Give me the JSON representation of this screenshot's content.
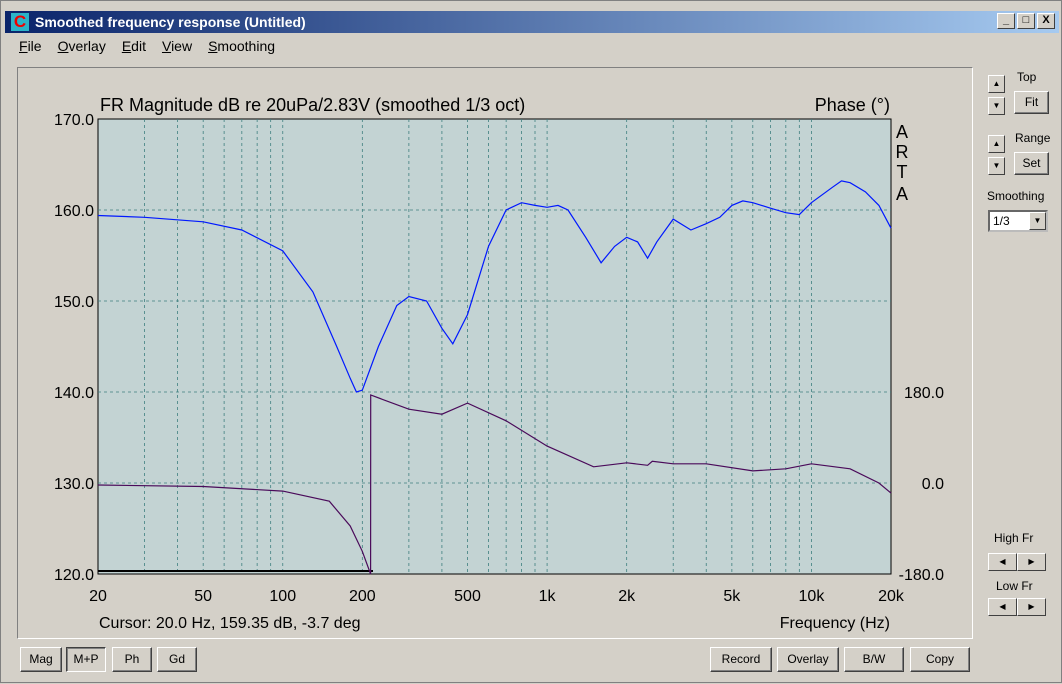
{
  "window": {
    "title": "Smoothed frequency response (Untitled)",
    "app_icon": "arta-icon",
    "controls": [
      "_",
      "□",
      "X"
    ]
  },
  "menu": [
    "File",
    "Overlay",
    "Edit",
    "View",
    "Smoothing"
  ],
  "plot": {
    "title": "FR Magnitude dB re 20uPa/2.83V (smoothed 1/3 oct)",
    "right_title": "Phase (°)",
    "watermark": [
      "A",
      "R",
      "T",
      "A"
    ],
    "cursor": "Cursor: 20.0 Hz, 159.35 dB, -3.7 deg",
    "xlabel": "Frequency (Hz)"
  },
  "side": {
    "top_label": "Top",
    "fit": "Fit",
    "range_label": "Range",
    "set": "Set",
    "smoothing_label": "Smoothing",
    "smoothing_value": "1/3",
    "high_fr": "High Fr",
    "low_fr": "Low Fr"
  },
  "buttons": {
    "mag": "Mag",
    "mp": "M+P",
    "ph": "Ph",
    "gd": "Gd",
    "record": "Record",
    "overlay": "Overlay",
    "bw": "B/W",
    "copy": "Copy"
  },
  "chart_data": {
    "type": "line",
    "xscale": "log",
    "xlim": [
      20,
      20000
    ],
    "ylim": [
      120,
      170
    ],
    "y2lim": [
      -180,
      180
    ],
    "xticks": [
      {
        "v": 20,
        "l": "20"
      },
      {
        "v": 50,
        "l": "50"
      },
      {
        "v": 100,
        "l": "100"
      },
      {
        "v": 200,
        "l": "200"
      },
      {
        "v": 500,
        "l": "500"
      },
      {
        "v": 1000,
        "l": "1k"
      },
      {
        "v": 2000,
        "l": "2k"
      },
      {
        "v": 5000,
        "l": "5k"
      },
      {
        "v": 10000,
        "l": "10k"
      },
      {
        "v": 20000,
        "l": "20k"
      }
    ],
    "yticks": [
      "120.0",
      "130.0",
      "140.0",
      "150.0",
      "160.0",
      "170.0"
    ],
    "y2ticks": [
      {
        "v": 180,
        "l": "180.0"
      },
      {
        "v": 0,
        "l": "0.0"
      },
      {
        "v": -180,
        "l": "-180.0"
      }
    ],
    "colors": {
      "magnitude": "#0018ff",
      "phase": "#4a0a5a",
      "bg": "#c3d3d3",
      "grid": "#3f7f7f"
    },
    "series": [
      {
        "name": "Magnitude (dB)",
        "axis": "left",
        "points": [
          [
            20,
            159.4
          ],
          [
            30,
            159.2
          ],
          [
            50,
            158.7
          ],
          [
            70,
            157.8
          ],
          [
            100,
            155.5
          ],
          [
            130,
            151
          ],
          [
            160,
            145
          ],
          [
            180,
            141.5
          ],
          [
            190,
            140
          ],
          [
            200,
            140.2
          ],
          [
            230,
            145
          ],
          [
            270,
            149.5
          ],
          [
            300,
            150.5
          ],
          [
            350,
            150
          ],
          [
            400,
            147
          ],
          [
            440,
            145.3
          ],
          [
            500,
            148.5
          ],
          [
            600,
            156
          ],
          [
            700,
            160
          ],
          [
            800,
            160.8
          ],
          [
            900,
            160.5
          ],
          [
            1000,
            160.3
          ],
          [
            1100,
            160.5
          ],
          [
            1200,
            160
          ],
          [
            1400,
            157
          ],
          [
            1600,
            154.2
          ],
          [
            1800,
            156
          ],
          [
            2000,
            157
          ],
          [
            2200,
            156.5
          ],
          [
            2400,
            154.7
          ],
          [
            2600,
            156.5
          ],
          [
            3000,
            159
          ],
          [
            3500,
            157.8
          ],
          [
            4000,
            158.5
          ],
          [
            4500,
            159.2
          ],
          [
            5000,
            160.5
          ],
          [
            5500,
            161
          ],
          [
            6000,
            160.8
          ],
          [
            7000,
            160.2
          ],
          [
            8000,
            159.7
          ],
          [
            9000,
            159.5
          ],
          [
            10000,
            160.8
          ],
          [
            12000,
            162.5
          ],
          [
            13000,
            163.2
          ],
          [
            14000,
            163
          ],
          [
            16000,
            162
          ],
          [
            18000,
            160.5
          ],
          [
            20000,
            158
          ]
        ]
      },
      {
        "name": "Phase (deg)",
        "axis": "right",
        "points": [
          [
            20,
            -4
          ],
          [
            50,
            -7
          ],
          [
            100,
            -16
          ],
          [
            150,
            -36
          ],
          [
            180,
            -85
          ],
          [
            200,
            -135
          ],
          [
            215,
            -180
          ],
          [
            215.1,
            174
          ],
          [
            300,
            146
          ],
          [
            400,
            136
          ],
          [
            500,
            158
          ],
          [
            700,
            123
          ],
          [
            1000,
            73
          ],
          [
            1500,
            32
          ],
          [
            2000,
            40
          ],
          [
            2400,
            35
          ],
          [
            2500,
            43
          ],
          [
            3000,
            38
          ],
          [
            4000,
            38
          ],
          [
            6000,
            24
          ],
          [
            8000,
            28
          ],
          [
            10000,
            38
          ],
          [
            14000,
            28
          ],
          [
            18000,
            0
          ],
          [
            20000,
            -20
          ]
        ]
      }
    ]
  }
}
